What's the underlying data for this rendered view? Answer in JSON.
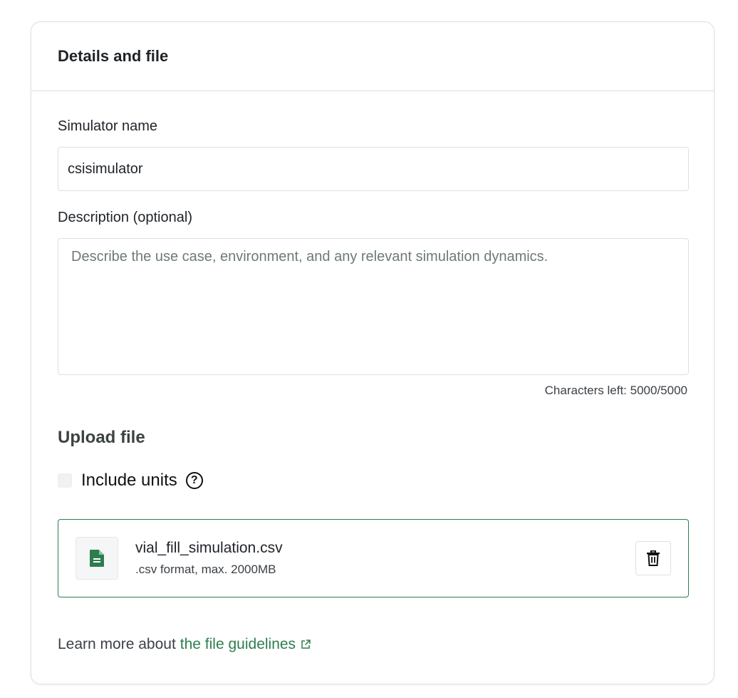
{
  "card": {
    "title": "Details and file"
  },
  "simulator_name": {
    "label": "Simulator name",
    "value": "csisimulator"
  },
  "description": {
    "label": "Description (optional)",
    "placeholder": "Describe the use case, environment, and any relevant simulation dynamics.",
    "value": "",
    "chars_left": "Characters left: 5000/5000"
  },
  "upload": {
    "title": "Upload file",
    "include_units_label": "Include units",
    "include_units_checked": false,
    "help_icon": "question-circle-icon",
    "file": {
      "name": "vial_fill_simulation.csv",
      "meta": ".csv format, max. 2000MB",
      "icon": "file-document-icon",
      "delete_icon": "trash-icon"
    }
  },
  "footer": {
    "learn_more_prefix": "Learn more about",
    "link_text": "the file guidelines",
    "link_icon": "external-link-icon"
  },
  "colors": {
    "accent": "#2e7d4f",
    "border": "#dcdfe3",
    "text": "#1f2328",
    "placeholder": "#6e7a76"
  }
}
